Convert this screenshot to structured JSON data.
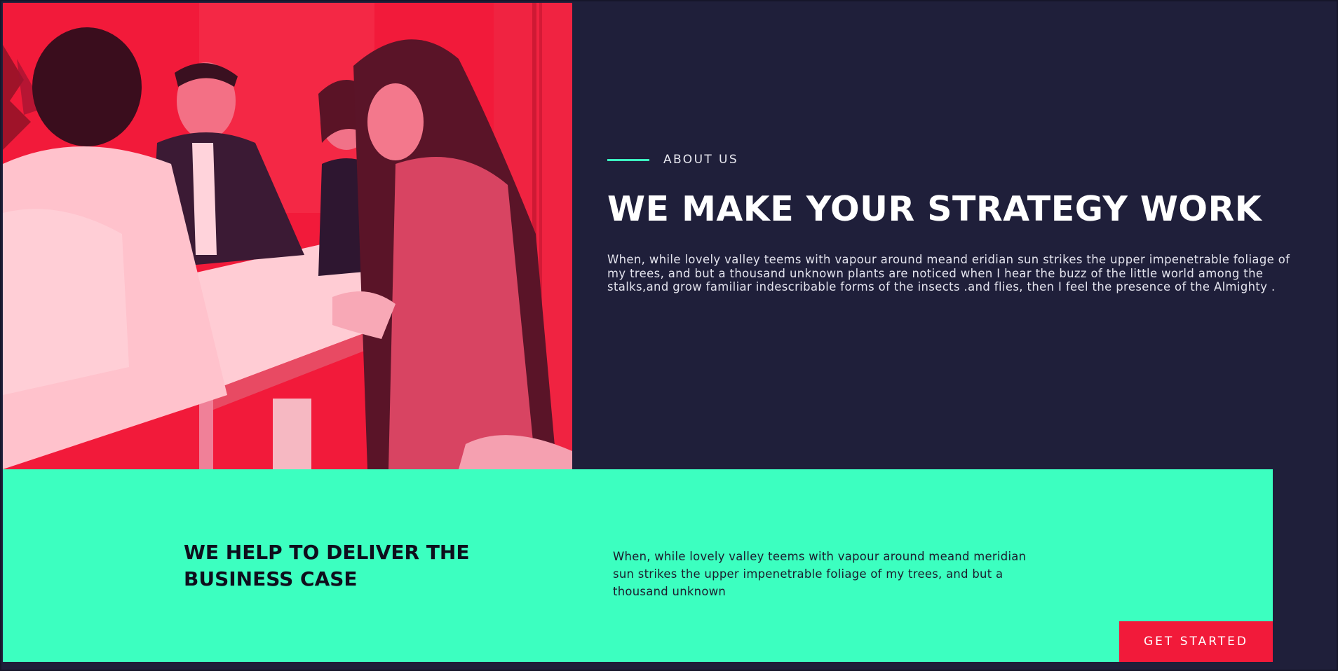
{
  "hero": {
    "image_alt": "team-meeting-photo",
    "tint_color": "#f21a3a"
  },
  "about": {
    "label": "ABOUT US",
    "headline": "WE MAKE YOUR STRATEGY WORK",
    "body": "When, while lovely valley teems with vapour around meand eridian sun strikes the upper impenetrable foliage of my trees, and but a thousand unknown plants are noticed when I hear the buzz of the little world among the stalks,and grow familiar indescribable forms of the insects .and flies, then I feel the presence of the Almighty .",
    "accent_color": "#3cffc0"
  },
  "cta": {
    "title": "WE HELP TO DELIVER THE BUSINESS CASE",
    "body": "When, while lovely valley teems with vapour around meand meridian sun strikes the upper impenetrable foliage of my trees, and but a thousand unknown",
    "button_label": "GET STARTED",
    "band_color": "#3cffc0",
    "button_color": "#f21a3a"
  },
  "colors": {
    "background": "#1f1f3a",
    "text_light": "#ffffff"
  }
}
